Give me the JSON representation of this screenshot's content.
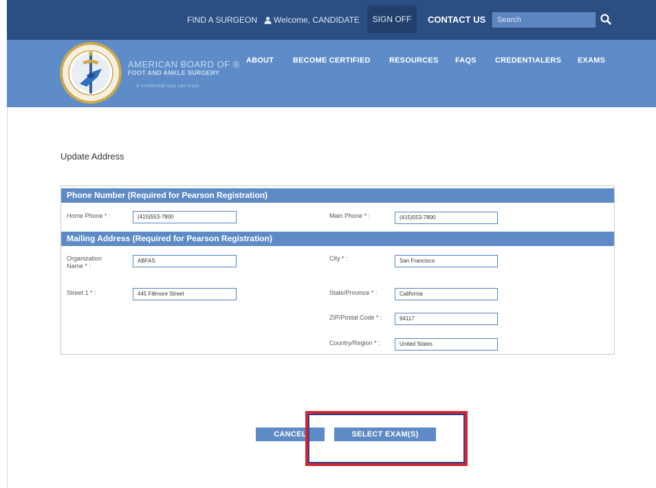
{
  "topbar": {
    "find_surgeon": "FIND A SURGEON",
    "welcome": "Welcome, CANDIDATE",
    "sign_off": "SIGN OFF",
    "contact_us": "CONTACT US",
    "search_placeholder": "Search"
  },
  "brand": {
    "line1": "AMERICAN BOARD OF ®",
    "line2": "FOOT AND ANKLE SURGERY",
    "tagline": "A credential you can trust."
  },
  "nav": [
    "ABOUT",
    "BECOME CERTIFIED",
    "RESOURCES",
    "FAQS",
    "CREDENTIALERS",
    "EXAMS"
  ],
  "page": {
    "title": "Update Address"
  },
  "phone_section": {
    "heading": "Phone Number (Required for Pearson Registration)",
    "home_phone_label": "Home Phone * :",
    "home_phone_value": "(415)553-7800",
    "main_phone_label": "Main Phone * :",
    "main_phone_value": "(415)553-7800"
  },
  "address_section": {
    "heading": "Mailing Address (Required for Pearson Registration)",
    "org_label_1": "Organization",
    "org_label_2": "Name * :",
    "org_value": "ABFAS",
    "street_label": "Street 1 * :",
    "street_value": "445 Fillmore Street",
    "city_label": "City * :",
    "city_value": "San Francisco",
    "state_label": "State/Province * :",
    "state_value": "California",
    "zip_label": "ZIP/Postal Code * :",
    "zip_value": "94117",
    "country_label": "Country/Region * :",
    "country_value": "United States"
  },
  "actions": {
    "cancel": "CANCEL",
    "select_exams": "SELECT EXAM(S)"
  },
  "colors": {
    "top_bar": "#2b4f83",
    "header": "#5d8cc8",
    "section_header": "#5e8bc5",
    "highlight": "#d6232e"
  }
}
